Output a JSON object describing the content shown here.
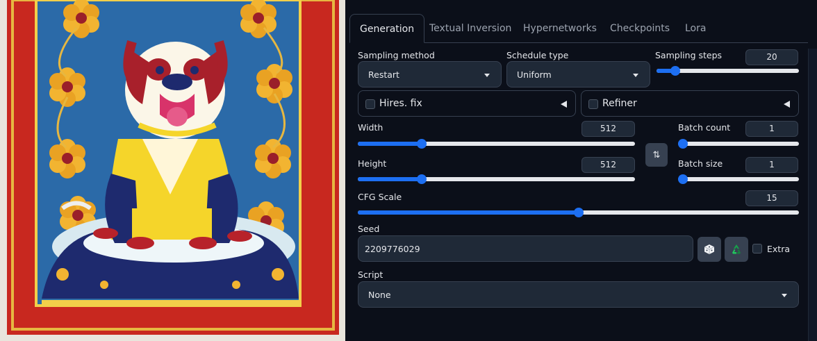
{
  "colors": {
    "panel_bg": "#0b0f19",
    "accent": "#1d6ff2",
    "field_bg": "#1f2937",
    "border": "#374151"
  },
  "tabs": [
    {
      "label": "Generation",
      "active": true
    },
    {
      "label": "Textual Inversion",
      "active": false
    },
    {
      "label": "Hypernetworks",
      "active": false
    },
    {
      "label": "Checkpoints",
      "active": false
    },
    {
      "label": "Lora",
      "active": false
    }
  ],
  "sampling_method": {
    "label": "Sampling method",
    "value": "Restart"
  },
  "schedule_type": {
    "label": "Schedule type",
    "value": "Uniform"
  },
  "sampling_steps": {
    "label": "Sampling steps",
    "value": "20",
    "fraction": 0.13
  },
  "hires_fix": {
    "label": "Hires. fix",
    "checked": false
  },
  "refiner": {
    "label": "Refiner",
    "checked": false
  },
  "width": {
    "label": "Width",
    "value": "512",
    "fraction": 0.23
  },
  "height": {
    "label": "Height",
    "value": "512",
    "fraction": 0.23
  },
  "batch_count": {
    "label": "Batch count",
    "value": "1",
    "fraction": 0.0
  },
  "batch_size": {
    "label": "Batch size",
    "value": "1",
    "fraction": 0.0
  },
  "cfg_scale": {
    "label": "CFG Scale",
    "value": "15",
    "fraction": 0.5
  },
  "swap_dims_icon": "⇅",
  "seed": {
    "label": "Seed",
    "value": "2209776029",
    "extra_label": "Extra",
    "dice_icon": "dice-icon",
    "recycle_icon": "recycle-icon"
  },
  "script": {
    "label": "Script",
    "value": "None"
  }
}
